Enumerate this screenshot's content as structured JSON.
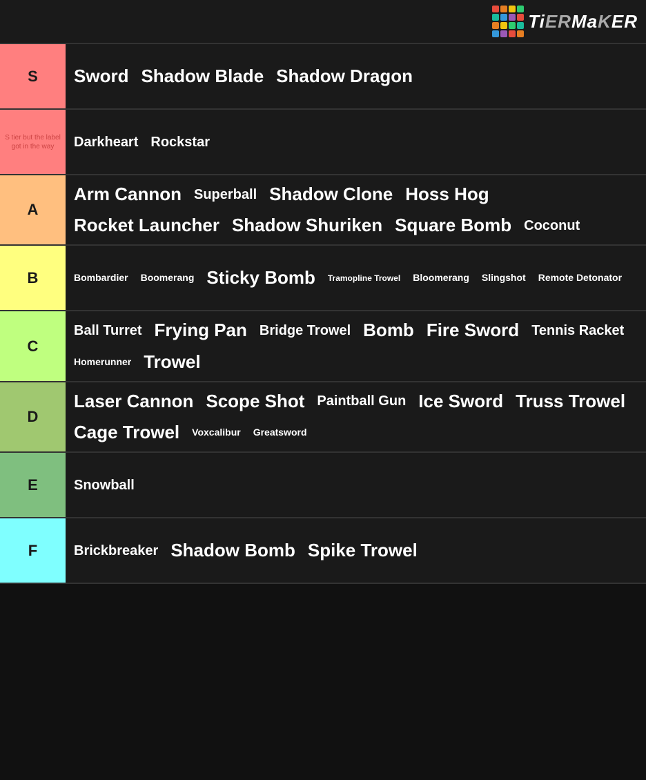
{
  "header": {
    "logo_text": "TiERMaKER"
  },
  "tiers": [
    {
      "id": "s",
      "label": "S",
      "color": "#ff7f7f",
      "items": [
        {
          "text": "Sword",
          "size": "large"
        },
        {
          "text": "Shadow Blade",
          "size": "large"
        },
        {
          "text": "Shadow Dragon",
          "size": "large"
        }
      ]
    },
    {
      "id": "s-note",
      "label": "S tier but the label got in the way",
      "color": "#ff7f7f",
      "label_special": true,
      "items": [
        {
          "text": "Darkheart",
          "size": "medium"
        },
        {
          "text": "Rockstar",
          "size": "medium"
        }
      ]
    },
    {
      "id": "a",
      "label": "A",
      "color": "#ffbf7f",
      "items": [
        {
          "text": "Arm Cannon",
          "size": "large"
        },
        {
          "text": "Superball",
          "size": "medium"
        },
        {
          "text": "Shadow Clone",
          "size": "large"
        },
        {
          "text": "Hoss Hog",
          "size": "large"
        },
        {
          "text": "Rocket Launcher",
          "size": "large"
        },
        {
          "text": "Shadow Shuriken",
          "size": "large"
        },
        {
          "text": "Square Bomb",
          "size": "large"
        },
        {
          "text": "Coconut",
          "size": "medium"
        }
      ]
    },
    {
      "id": "b",
      "label": "B",
      "color": "#ffff7f",
      "items": [
        {
          "text": "Bombardier",
          "size": "small"
        },
        {
          "text": "Boomerang",
          "size": "small"
        },
        {
          "text": "Sticky Bomb",
          "size": "large"
        },
        {
          "text": "Tramopline Trowel",
          "size": "xsmall"
        },
        {
          "text": "Bloomerang",
          "size": "small"
        },
        {
          "text": "Slingshot",
          "size": "small"
        },
        {
          "text": "Remote Detonator",
          "size": "small"
        }
      ]
    },
    {
      "id": "c",
      "label": "C",
      "color": "#bfff7f",
      "items": [
        {
          "text": "Ball Turret",
          "size": "medium"
        },
        {
          "text": "Frying Pan",
          "size": "large"
        },
        {
          "text": "Bridge Trowel",
          "size": "medium"
        },
        {
          "text": "Bomb",
          "size": "large"
        },
        {
          "text": "Fire Sword",
          "size": "large"
        },
        {
          "text": "Tennis Racket",
          "size": "medium"
        },
        {
          "text": "Homerunner",
          "size": "small"
        },
        {
          "text": "Trowel",
          "size": "large"
        }
      ]
    },
    {
      "id": "d",
      "label": "D",
      "color": "#a0c870",
      "items": [
        {
          "text": "Laser Cannon",
          "size": "large"
        },
        {
          "text": "Scope Shot",
          "size": "large"
        },
        {
          "text": "Paintball Gun",
          "size": "medium"
        },
        {
          "text": "Ice Sword",
          "size": "large"
        },
        {
          "text": "Truss Trowel",
          "size": "large"
        },
        {
          "text": "Cage Trowel",
          "size": "large"
        },
        {
          "text": "Voxcalibur",
          "size": "small"
        },
        {
          "text": "Greatsword",
          "size": "small"
        }
      ]
    },
    {
      "id": "e",
      "label": "E",
      "color": "#7fbf7f",
      "items": [
        {
          "text": "Snowball",
          "size": "medium"
        }
      ]
    },
    {
      "id": "f",
      "label": "F",
      "color": "#7fffff",
      "items": [
        {
          "text": "Brickbreaker",
          "size": "medium"
        },
        {
          "text": "Shadow Bomb",
          "size": "large"
        },
        {
          "text": "Spike Trowel",
          "size": "large"
        }
      ]
    }
  ],
  "logo_colors": [
    "#e74c3c",
    "#e67e22",
    "#f1c40f",
    "#2ecc71",
    "#1abc9c",
    "#3498db",
    "#9b59b6",
    "#e74c3c",
    "#e67e22",
    "#f1c40f",
    "#2ecc71",
    "#1abc9c",
    "#3498db",
    "#9b59b6",
    "#e74c3c",
    "#e67e22"
  ]
}
